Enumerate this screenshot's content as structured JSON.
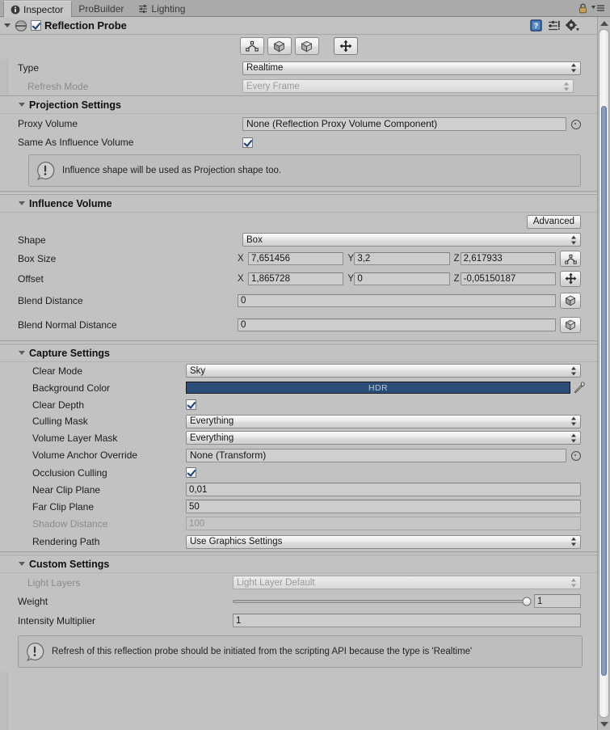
{
  "tabs": [
    {
      "id": "inspector",
      "label": "Inspector",
      "icon": "info-icon",
      "active": true
    },
    {
      "id": "probuilder",
      "label": "ProBuilder",
      "icon": "none",
      "active": false
    },
    {
      "id": "lighting",
      "label": "Lighting",
      "icon": "sliders-icon",
      "active": false
    }
  ],
  "tabbar_right": {
    "lock_icon": "lock-icon",
    "menu_icon": "hamburger-menu-icon"
  },
  "component": {
    "title": "Reflection Probe",
    "enabled": true,
    "expanded": true,
    "icon": "reflection-probe-icon",
    "right_icons": [
      "help-icon",
      "preset-icon",
      "gear-icon"
    ]
  },
  "gizmo_toolbar": [
    {
      "name": "edit-bounds-icon",
      "selected": false
    },
    {
      "name": "edit-influence-box-icon",
      "selected": false
    },
    {
      "name": "edit-blend-box-icon",
      "selected": false
    },
    {
      "name": "move-probe-icon",
      "selected": true
    }
  ],
  "type_row": {
    "label": "Type",
    "value": "Realtime"
  },
  "refresh_row": {
    "label": "Refresh Mode",
    "value": "Every Frame",
    "disabled": true
  },
  "projection": {
    "title": "Projection Settings",
    "proxy_volume": {
      "label": "Proxy Volume",
      "value": "None (Reflection Proxy Volume Component)"
    },
    "same_as_influence": {
      "label": "Same As Influence Volume",
      "checked": true
    },
    "info": "Influence shape will be used as Projection shape too."
  },
  "influence": {
    "title": "Influence Volume",
    "advanced_label": "Advanced",
    "shape": {
      "label": "Shape",
      "value": "Box"
    },
    "box_size": {
      "label": "Box Size",
      "x": "7,651456",
      "y": "3,2",
      "z": "2,617933",
      "gizmo": "edit-bounds-icon"
    },
    "offset": {
      "label": "Offset",
      "x": "1,865728",
      "y": "0",
      "z": "-0,05150187",
      "gizmo": "move-probe-icon"
    },
    "blend_distance": {
      "label": "Blend Distance",
      "value": "0",
      "gizmo": "edit-blend-box-icon"
    },
    "blend_normal_distance": {
      "label": "Blend Normal Distance",
      "value": "0",
      "gizmo": "edit-blend-normal-box-icon"
    },
    "axis_x": "X",
    "axis_y": "Y",
    "axis_z": "Z"
  },
  "capture": {
    "title": "Capture Settings",
    "clear_mode": {
      "label": "Clear Mode",
      "value": "Sky"
    },
    "background_color": {
      "label": "Background Color",
      "hdr_label": "HDR",
      "color": "#2c4d78"
    },
    "clear_depth": {
      "label": "Clear Depth",
      "checked": true
    },
    "culling_mask": {
      "label": "Culling Mask",
      "value": "Everything"
    },
    "volume_layer_mask": {
      "label": "Volume Layer Mask",
      "value": "Everything"
    },
    "volume_anchor_override": {
      "label": "Volume Anchor Override",
      "value": "None (Transform)"
    },
    "occlusion_culling": {
      "label": "Occlusion Culling",
      "checked": true
    },
    "near_clip_plane": {
      "label": "Near Clip Plane",
      "value": "0,01"
    },
    "far_clip_plane": {
      "label": "Far Clip Plane",
      "value": "50"
    },
    "shadow_distance": {
      "label": "Shadow Distance",
      "value": "100",
      "disabled": true
    },
    "rendering_path": {
      "label": "Rendering Path",
      "value": "Use Graphics Settings"
    }
  },
  "custom": {
    "title": "Custom Settings",
    "light_layers": {
      "label": "Light Layers",
      "value": "Light Layer Default",
      "disabled": true
    },
    "weight": {
      "label": "Weight",
      "value": "1",
      "slider_percent": 100
    },
    "intensity_multiplier": {
      "label": "Intensity Multiplier",
      "value": "1"
    }
  },
  "bottom_info": "Refresh of this reflection probe should be initiated from the scripting API because the type is 'Realtime'",
  "scrollbar": {
    "thumb_top_pct": 11,
    "thumb_height_pct": 83
  }
}
